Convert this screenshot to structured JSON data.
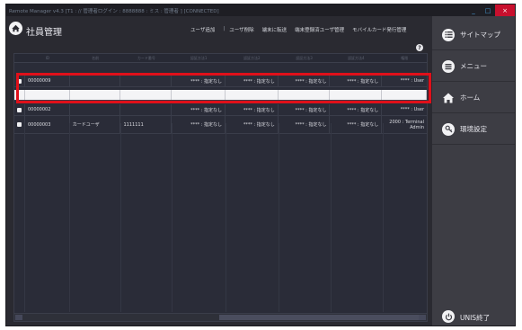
{
  "window": {
    "title": "Remote Manager v4.3 [T1 : // 管理者ログイン : 8888888 : ミス : 管理者 ] [CONNECTED]",
    "controls": [
      "_",
      "□",
      "×"
    ]
  },
  "header": {
    "title": "社員管理",
    "links": [
      "ユーザ追加",
      "ユーザ削除",
      "端末に転送",
      "端末登録済ユーザ管理",
      "モバイルカード発行管理"
    ]
  },
  "table": {
    "columns": [
      "",
      "ID",
      "名前",
      "カード番号",
      "認証方法1",
      "認証方法2",
      "認証方法3",
      "認証方法4",
      "権限"
    ],
    "rows": [
      {
        "id": "00000009",
        "name": "",
        "card": "",
        "auth1": "**** : 指定なし",
        "auth2": "**** : 指定なし",
        "auth3": "**** : 指定なし",
        "auth4": "**** : 指定なし",
        "role": "**** : User"
      },
      {
        "id": "",
        "name": "",
        "card": "",
        "auth1": "",
        "auth2": "",
        "auth3": "",
        "auth4": "",
        "role": ""
      },
      {
        "id": "00000002",
        "name": "",
        "card": "",
        "auth1": "**** : 指定なし",
        "auth2": "**** : 指定なし",
        "auth3": "**** : 指定なし",
        "auth4": "**** : 指定なし",
        "role": "**** : User"
      },
      {
        "id": "00000003",
        "name": "カードユーザ",
        "card": "1111111",
        "auth1": "**** : 指定なし",
        "auth2": "**** : 指定なし",
        "auth3": "**** : 指定なし",
        "auth4": "**** : 指定なし",
        "role_line1": "2000 : Terminal",
        "role_line2": "Admin"
      }
    ]
  },
  "sidebar": {
    "items": [
      {
        "label": "サイトマップ",
        "icon": "sitemap-list-icon"
      },
      {
        "label": "メニュー",
        "icon": "menu-icon"
      },
      {
        "label": "ホーム",
        "icon": "home-icon"
      },
      {
        "label": "環境設定",
        "icon": "settings-keys-icon"
      }
    ],
    "exit_label": "UNIS終了"
  },
  "colors": {
    "background": "#2a2a31",
    "sidebar": "#3d3d44",
    "highlight": "#e0101a",
    "close_button": "#c8102e"
  }
}
